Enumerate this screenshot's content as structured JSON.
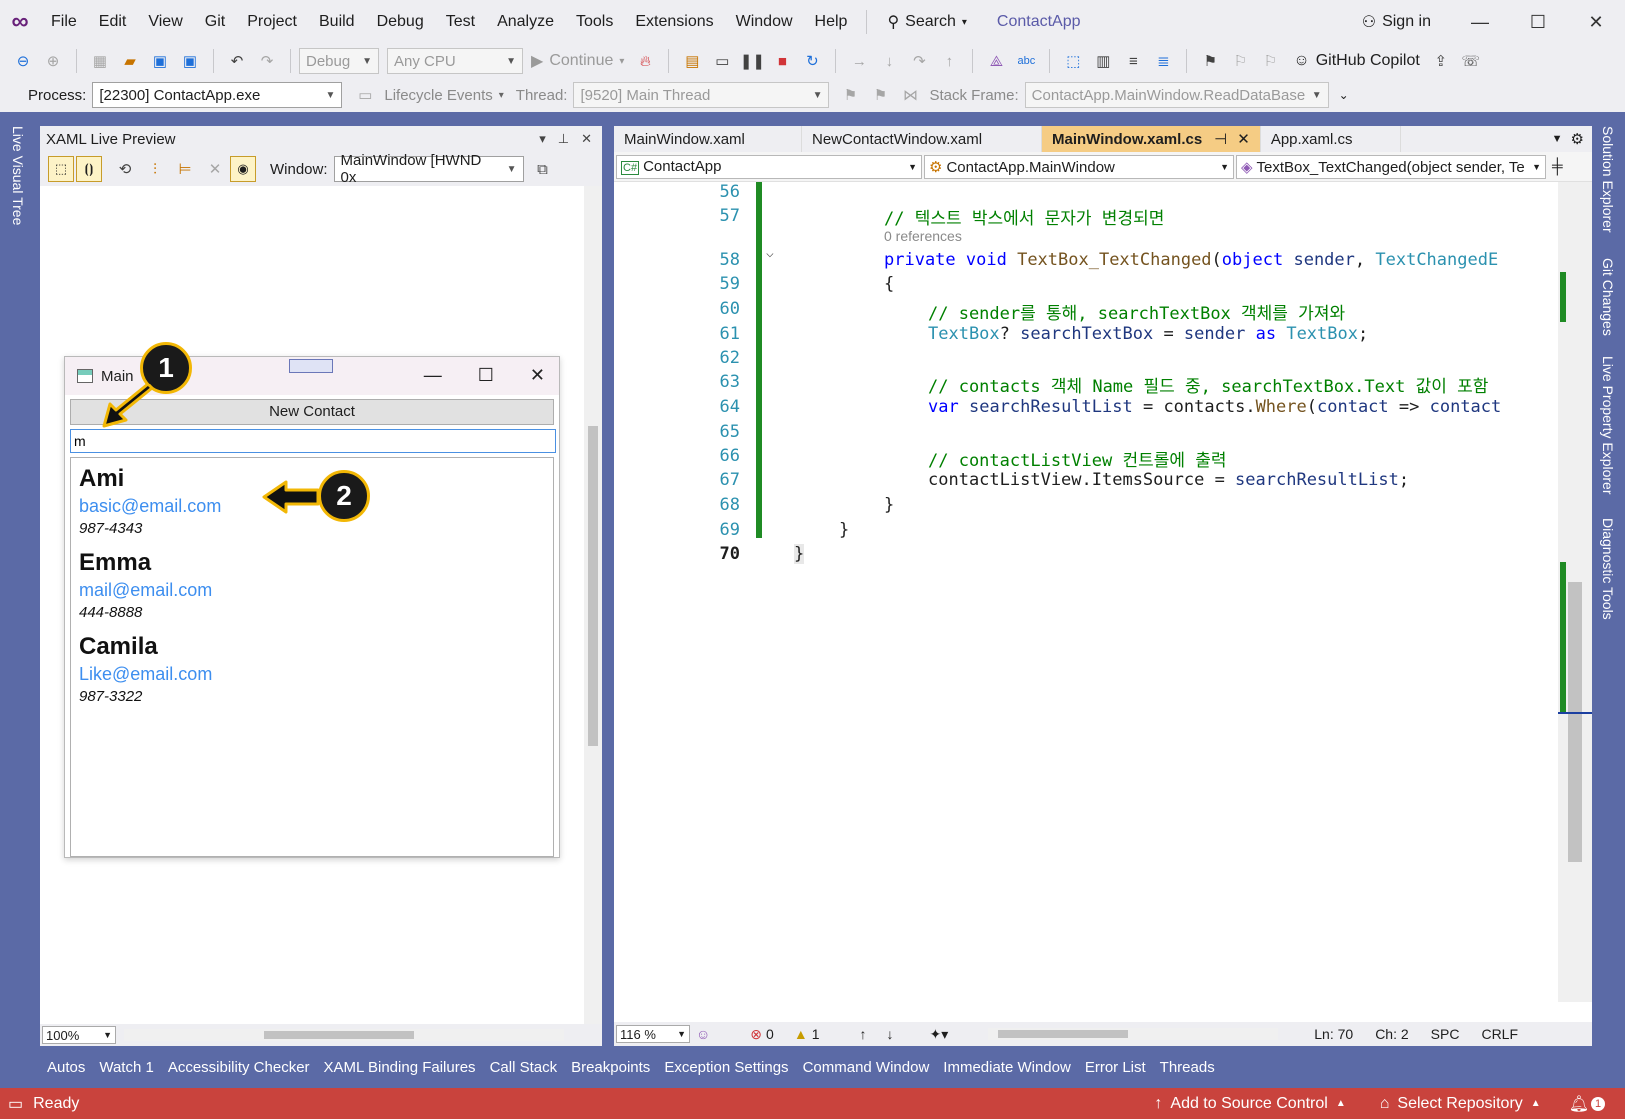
{
  "menubar": {
    "items": [
      "File",
      "Edit",
      "View",
      "Git",
      "Project",
      "Build",
      "Debug",
      "Test",
      "Analyze",
      "Tools",
      "Extensions",
      "Window",
      "Help"
    ],
    "search_label": "Search",
    "app_title": "ContactApp",
    "sign_in": "Sign in"
  },
  "toolbar1": {
    "config": "Debug",
    "platform": "Any CPU",
    "continue_label": "Continue",
    "copilot_label": "GitHub Copilot"
  },
  "toolbar2": {
    "process_label": "Process:",
    "process_value": "[22300] ContactApp.exe",
    "lifecycle_label": "Lifecycle Events",
    "thread_label": "Thread:",
    "thread_value": "[9520] Main Thread",
    "stackframe_label": "Stack Frame:",
    "stackframe_value": "ContactApp.MainWindow.ReadDataBase"
  },
  "side_left": {
    "label": "Live Visual Tree"
  },
  "side_right": {
    "labels": [
      "Solution Explorer",
      "Git Changes",
      "Live Property Explorer",
      "Diagnostic Tools"
    ]
  },
  "xaml_preview": {
    "title": "XAML Live Preview",
    "window_label": "Window:",
    "window_value": "MainWindow [HWND 0x",
    "zoom": "100%"
  },
  "wpf_window": {
    "title": "Main",
    "new_contact_button": "New Contact",
    "search_value": "m",
    "contacts": [
      {
        "name": "Ami",
        "email": "basic@email.com",
        "phone": "987-4343"
      },
      {
        "name": "Emma",
        "email": "mail@email.com",
        "phone": "444-8888"
      },
      {
        "name": "Camila",
        "email": "Like@email.com",
        "phone": "987-3322"
      }
    ]
  },
  "annotations": {
    "badge1": "1",
    "badge2": "2"
  },
  "editor": {
    "tabs": [
      "MainWindow.xaml",
      "NewContactWindow.xaml",
      "MainWindow.xaml.cs",
      "App.xaml.cs"
    ],
    "active_tab_index": 2,
    "nav": {
      "project": "ContactApp",
      "class": "ContactApp.MainWindow",
      "member": "TextBox_TextChanged(object sender, Te"
    },
    "references": "0 references",
    "zoom": "116 %",
    "errors": "0",
    "warnings": "1",
    "line": "Ln: 70",
    "col": "Ch: 2",
    "spc": "SPC",
    "eol": "CRLF",
    "lines": [
      {
        "n": "56",
        "t": ""
      },
      {
        "n": "57",
        "t": "// 텍스트 박스에서 문자가 변경되면"
      },
      {
        "n": "58",
        "t": "private void TextBox_TextChanged(object sender, TextChangedE"
      },
      {
        "n": "59",
        "t": "{"
      },
      {
        "n": "60",
        "t": "// sender를 통해, searchTextBox 객체를 가져와"
      },
      {
        "n": "61",
        "t": "TextBox? searchTextBox = sender as TextBox;"
      },
      {
        "n": "62",
        "t": ""
      },
      {
        "n": "63",
        "t": "// contacts 객체 Name 필드 중, searchTextBox.Text 값이 포함"
      },
      {
        "n": "64",
        "t": "var searchResultList = contacts.Where(contact => contact"
      },
      {
        "n": "65",
        "t": ""
      },
      {
        "n": "66",
        "t": "// contactListView 컨트롤에 출력"
      },
      {
        "n": "67",
        "t": "contactListView.ItemsSource = searchResultList;"
      },
      {
        "n": "68",
        "t": "}"
      },
      {
        "n": "69",
        "t": "}"
      },
      {
        "n": "70",
        "t": "}"
      }
    ]
  },
  "bottom_tabs": [
    "Autos",
    "Watch 1",
    "Accessibility Checker",
    "XAML Binding Failures",
    "Call Stack",
    "Breakpoints",
    "Exception Settings",
    "Command Window",
    "Immediate Window",
    "Error List",
    "Threads"
  ],
  "statusbar": {
    "ready": "Ready",
    "add_source": "Add to Source Control",
    "select_repo": "Select Repository",
    "notifications": "1"
  },
  "colors": {
    "accent": "#5b6aa6",
    "status": "#c9433d",
    "active_tab": "#f5cc84",
    "badge_border": "#f2b705"
  }
}
